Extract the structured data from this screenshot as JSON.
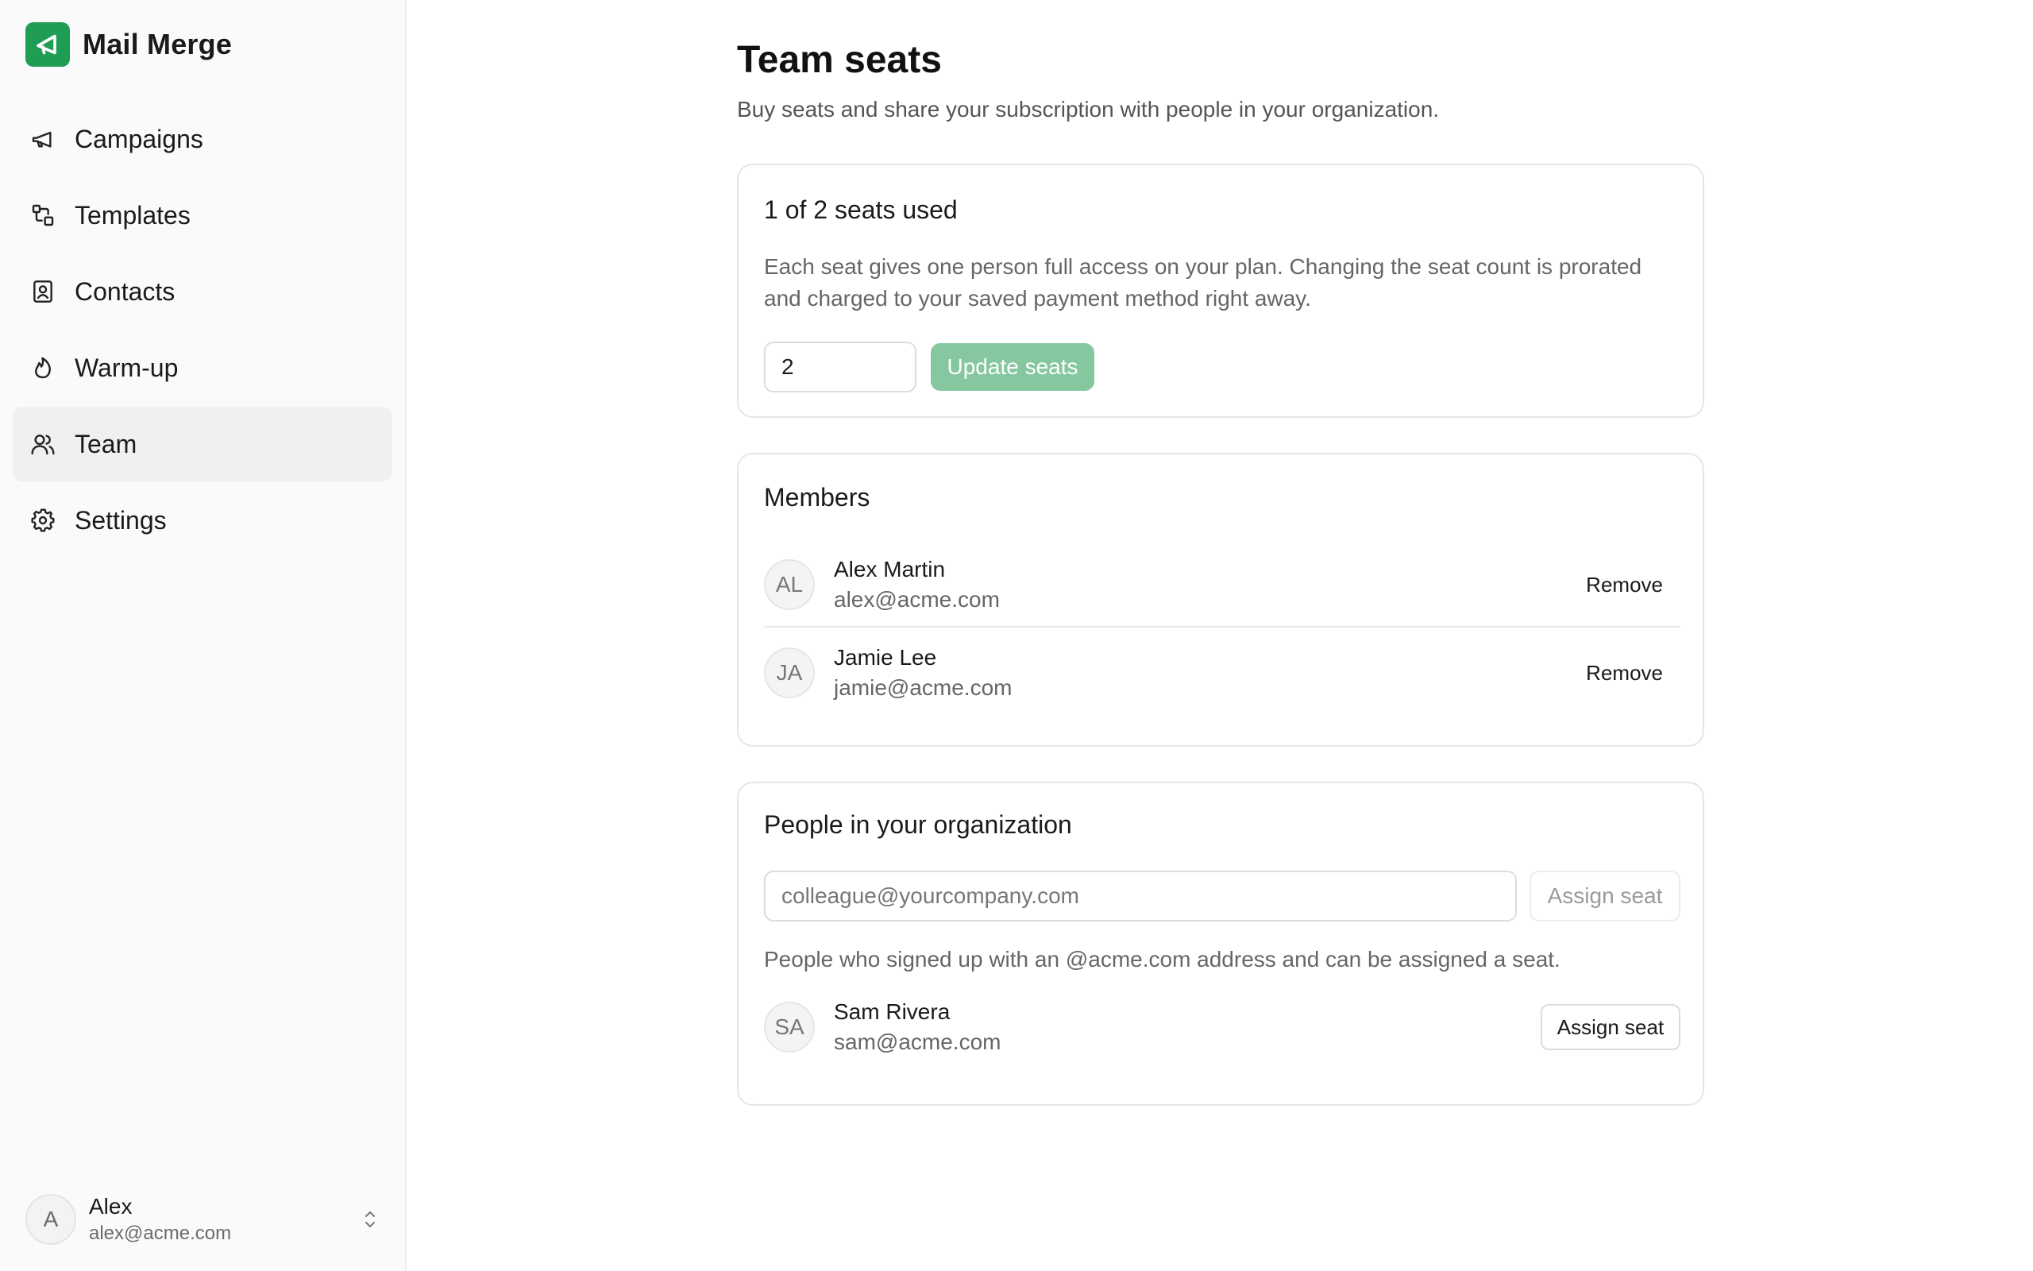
{
  "app": {
    "name": "Mail Merge",
    "brand_color": "#1f9d55"
  },
  "sidebar": {
    "items": [
      {
        "label": "Campaigns",
        "icon": "megaphone-icon"
      },
      {
        "label": "Templates",
        "icon": "shapes-icon"
      },
      {
        "label": "Contacts",
        "icon": "contact-book-icon"
      },
      {
        "label": "Warm-up",
        "icon": "flame-icon"
      },
      {
        "label": "Team",
        "icon": "users-icon",
        "active": true
      },
      {
        "label": "Settings",
        "icon": "gear-icon"
      }
    ],
    "account": {
      "initial": "A",
      "name": "Alex",
      "email": "alex@acme.com"
    }
  },
  "page": {
    "title": "Team seats",
    "subtitle": "Buy seats and share your subscription with people in your organization."
  },
  "seats": {
    "title": "1 of 2 seats used",
    "description": "Each seat gives one person full access on your plan. Changing the seat count is prorated and charged to your saved payment method right away.",
    "count_value": "2",
    "update_label": "Update seats",
    "update_color": "#86c7a0"
  },
  "members": {
    "title": "Members",
    "list": [
      {
        "initials": "AL",
        "name": "Alex Martin",
        "email": "alex@acme.com",
        "action": "Remove"
      },
      {
        "initials": "JA",
        "name": "Jamie Lee",
        "email": "jamie@acme.com",
        "action": "Remove"
      }
    ]
  },
  "organization": {
    "title": "People in your organization",
    "email_placeholder": "colleague@yourcompany.com",
    "assign_label": "Assign seat",
    "note": "People who signed up with an @acme.com address and can be assigned a seat.",
    "people": [
      {
        "initials": "SA",
        "name": "Sam Rivera",
        "email": "sam@acme.com",
        "action": "Assign seat"
      }
    ]
  }
}
